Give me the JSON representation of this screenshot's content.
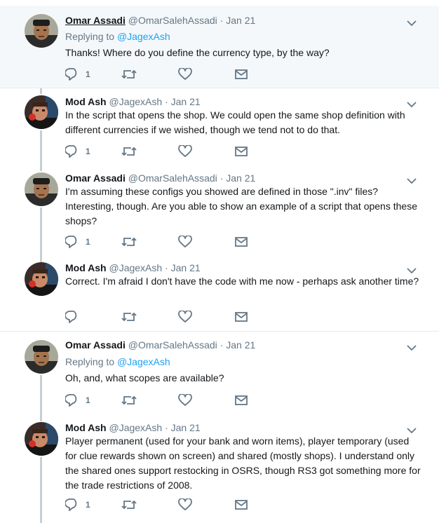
{
  "tweets": [
    {
      "name": "Omar Assadi",
      "handle": "@OmarSalehAssadi",
      "separator": "·",
      "date": "Jan 21",
      "replying_label": "Replying to",
      "replying_handle": "@JagexAsh",
      "text": "Thanks! Where do you define the currency type, by the way?",
      "reply_count": "1",
      "avatar": "omar"
    },
    {
      "name": "Mod Ash",
      "handle": "@JagexAsh",
      "separator": "·",
      "date": "Jan 21",
      "text": "In the script that opens the shop. We could open the same shop definition with different currencies if we wished, though we tend not to do that.",
      "reply_count": "1",
      "avatar": "ash"
    },
    {
      "name": "Omar Assadi",
      "handle": "@OmarSalehAssadi",
      "separator": "·",
      "date": "Jan 21",
      "text": "I'm assuming these configs you showed are defined in those \".inv\" files? Interesting, though. Are you able to show an example of a script that opens these shops?",
      "reply_count": "1",
      "avatar": "omar"
    },
    {
      "name": "Mod Ash",
      "handle": "@JagexAsh",
      "separator": "·",
      "date": "Jan 21",
      "text": "Correct. I'm afraid I don't have the code with me now - perhaps ask another time?",
      "reply_count": "",
      "avatar": "ash"
    },
    {
      "name": "Omar Assadi",
      "handle": "@OmarSalehAssadi",
      "separator": "·",
      "date": "Jan 21",
      "replying_label": "Replying to",
      "replying_handle": "@JagexAsh",
      "text": "Oh, and, what scopes are available?",
      "reply_count": "1",
      "avatar": "omar"
    },
    {
      "name": "Mod Ash",
      "handle": "@JagexAsh",
      "separator": "·",
      "date": "Jan 21",
      "text": "Player permanent (used for your bank and worn items), player temporary (used for clue rewards shown on screen) and shared (mostly shops). I understand only the shared ones support restocking in OSRS, though RS3 got something more for the trade restrictions of 2008.",
      "reply_count": "1",
      "avatar": "ash"
    }
  ],
  "icons": {
    "reply": "reply-icon",
    "retweet": "retweet-icon",
    "like": "heart-icon",
    "dm": "envelope-icon",
    "more": "chevron-down-icon"
  },
  "colors": {
    "highlight_bg": "#f5f8fa",
    "muted": "#657786",
    "link": "#1da1f2",
    "thread_line": "#c4cfd6",
    "border": "#e6ecf0"
  }
}
